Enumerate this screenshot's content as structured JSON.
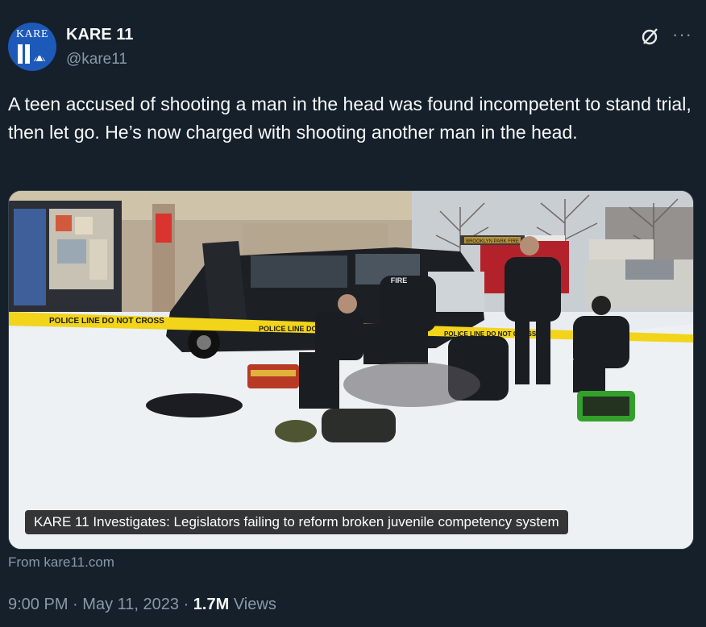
{
  "author": {
    "avatar_text": "KARE",
    "name": "KARE 11",
    "handle": "@kare11"
  },
  "tweet": {
    "text": "A teen accused of shooting a man in the head was found incompetent to stand trial, then let go. He’s now charged with shooting another man in the head."
  },
  "card": {
    "caption": "KARE 11 Investigates: Legislators failing to reform broken juvenile competency system",
    "tape_text": "POLICE LINE DO NOT CROSS",
    "store_sign": "BROOKLYN PARK FIRE",
    "jacket_text": "FIRE",
    "source": "From kare11.com"
  },
  "meta": {
    "time": "9:00 PM",
    "separator": "·",
    "date": "May 11, 2023",
    "views_count": "1.7M",
    "views_label": "Views"
  },
  "icons": {
    "grok": "grok-icon",
    "more": "more-icon"
  },
  "colors": {
    "background": "#15202b",
    "text": "#f7f9f9",
    "secondary": "#8b98a5",
    "border": "#38444d",
    "tape": "#f2d41a"
  }
}
